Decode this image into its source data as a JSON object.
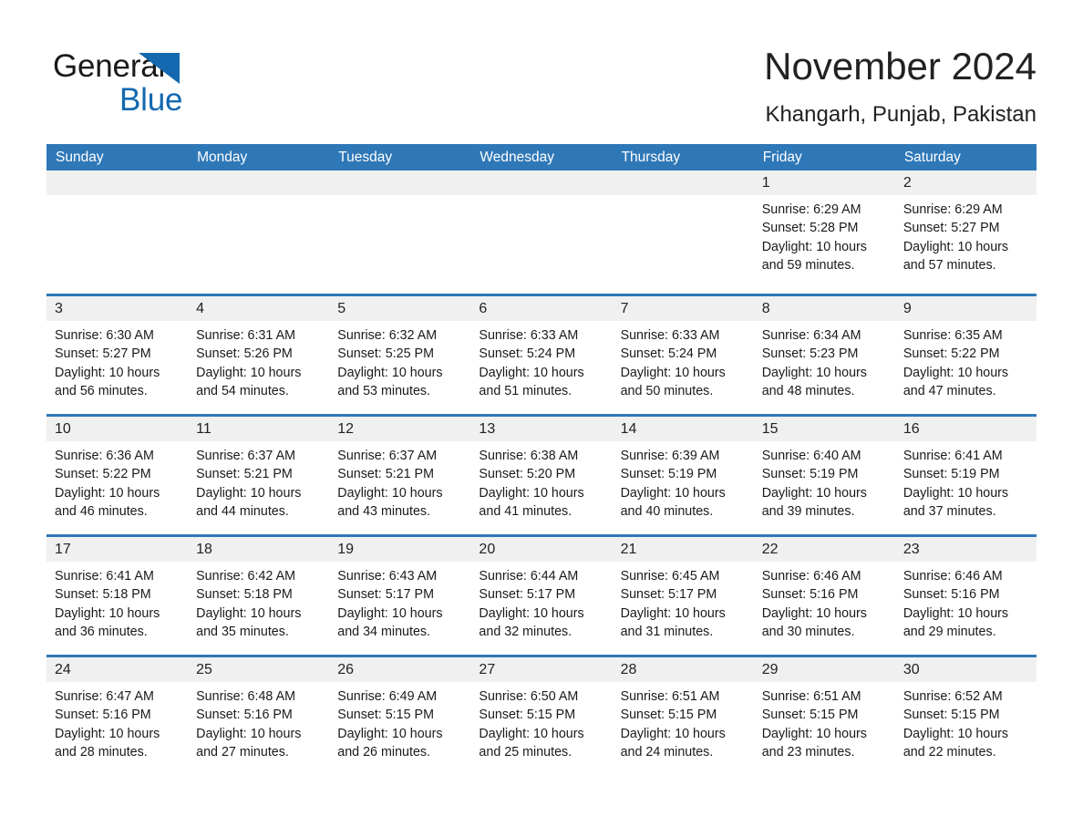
{
  "logo": {
    "word_one": "General",
    "word_two": "Blue",
    "triangle_icon": "triangle-icon",
    "brand_color": "#1368b0"
  },
  "header": {
    "month_title": "November 2024",
    "location": "Khangarh, Punjab, Pakistan"
  },
  "colors": {
    "header_blue": "#2f78b8",
    "day_strip_gray": "#f0f0f0",
    "text": "#1a1a1a"
  },
  "weekdays": [
    "Sunday",
    "Monday",
    "Tuesday",
    "Wednesday",
    "Thursday",
    "Friday",
    "Saturday"
  ],
  "weeks": [
    [
      {
        "day": "",
        "empty": true
      },
      {
        "day": "",
        "empty": true
      },
      {
        "day": "",
        "empty": true
      },
      {
        "day": "",
        "empty": true
      },
      {
        "day": "",
        "empty": true
      },
      {
        "day": "1",
        "sunrise": "Sunrise: 6:29 AM",
        "sunset": "Sunset: 5:28 PM",
        "daylight_1": "Daylight: 10 hours",
        "daylight_2": "and 59 minutes."
      },
      {
        "day": "2",
        "sunrise": "Sunrise: 6:29 AM",
        "sunset": "Sunset: 5:27 PM",
        "daylight_1": "Daylight: 10 hours",
        "daylight_2": "and 57 minutes."
      }
    ],
    [
      {
        "day": "3",
        "sunrise": "Sunrise: 6:30 AM",
        "sunset": "Sunset: 5:27 PM",
        "daylight_1": "Daylight: 10 hours",
        "daylight_2": "and 56 minutes."
      },
      {
        "day": "4",
        "sunrise": "Sunrise: 6:31 AM",
        "sunset": "Sunset: 5:26 PM",
        "daylight_1": "Daylight: 10 hours",
        "daylight_2": "and 54 minutes."
      },
      {
        "day": "5",
        "sunrise": "Sunrise: 6:32 AM",
        "sunset": "Sunset: 5:25 PM",
        "daylight_1": "Daylight: 10 hours",
        "daylight_2": "and 53 minutes."
      },
      {
        "day": "6",
        "sunrise": "Sunrise: 6:33 AM",
        "sunset": "Sunset: 5:24 PM",
        "daylight_1": "Daylight: 10 hours",
        "daylight_2": "and 51 minutes."
      },
      {
        "day": "7",
        "sunrise": "Sunrise: 6:33 AM",
        "sunset": "Sunset: 5:24 PM",
        "daylight_1": "Daylight: 10 hours",
        "daylight_2": "and 50 minutes."
      },
      {
        "day": "8",
        "sunrise": "Sunrise: 6:34 AM",
        "sunset": "Sunset: 5:23 PM",
        "daylight_1": "Daylight: 10 hours",
        "daylight_2": "and 48 minutes."
      },
      {
        "day": "9",
        "sunrise": "Sunrise: 6:35 AM",
        "sunset": "Sunset: 5:22 PM",
        "daylight_1": "Daylight: 10 hours",
        "daylight_2": "and 47 minutes."
      }
    ],
    [
      {
        "day": "10",
        "sunrise": "Sunrise: 6:36 AM",
        "sunset": "Sunset: 5:22 PM",
        "daylight_1": "Daylight: 10 hours",
        "daylight_2": "and 46 minutes."
      },
      {
        "day": "11",
        "sunrise": "Sunrise: 6:37 AM",
        "sunset": "Sunset: 5:21 PM",
        "daylight_1": "Daylight: 10 hours",
        "daylight_2": "and 44 minutes."
      },
      {
        "day": "12",
        "sunrise": "Sunrise: 6:37 AM",
        "sunset": "Sunset: 5:21 PM",
        "daylight_1": "Daylight: 10 hours",
        "daylight_2": "and 43 minutes."
      },
      {
        "day": "13",
        "sunrise": "Sunrise: 6:38 AM",
        "sunset": "Sunset: 5:20 PM",
        "daylight_1": "Daylight: 10 hours",
        "daylight_2": "and 41 minutes."
      },
      {
        "day": "14",
        "sunrise": "Sunrise: 6:39 AM",
        "sunset": "Sunset: 5:19 PM",
        "daylight_1": "Daylight: 10 hours",
        "daylight_2": "and 40 minutes."
      },
      {
        "day": "15",
        "sunrise": "Sunrise: 6:40 AM",
        "sunset": "Sunset: 5:19 PM",
        "daylight_1": "Daylight: 10 hours",
        "daylight_2": "and 39 minutes."
      },
      {
        "day": "16",
        "sunrise": "Sunrise: 6:41 AM",
        "sunset": "Sunset: 5:19 PM",
        "daylight_1": "Daylight: 10 hours",
        "daylight_2": "and 37 minutes."
      }
    ],
    [
      {
        "day": "17",
        "sunrise": "Sunrise: 6:41 AM",
        "sunset": "Sunset: 5:18 PM",
        "daylight_1": "Daylight: 10 hours",
        "daylight_2": "and 36 minutes."
      },
      {
        "day": "18",
        "sunrise": "Sunrise: 6:42 AM",
        "sunset": "Sunset: 5:18 PM",
        "daylight_1": "Daylight: 10 hours",
        "daylight_2": "and 35 minutes."
      },
      {
        "day": "19",
        "sunrise": "Sunrise: 6:43 AM",
        "sunset": "Sunset: 5:17 PM",
        "daylight_1": "Daylight: 10 hours",
        "daylight_2": "and 34 minutes."
      },
      {
        "day": "20",
        "sunrise": "Sunrise: 6:44 AM",
        "sunset": "Sunset: 5:17 PM",
        "daylight_1": "Daylight: 10 hours",
        "daylight_2": "and 32 minutes."
      },
      {
        "day": "21",
        "sunrise": "Sunrise: 6:45 AM",
        "sunset": "Sunset: 5:17 PM",
        "daylight_1": "Daylight: 10 hours",
        "daylight_2": "and 31 minutes."
      },
      {
        "day": "22",
        "sunrise": "Sunrise: 6:46 AM",
        "sunset": "Sunset: 5:16 PM",
        "daylight_1": "Daylight: 10 hours",
        "daylight_2": "and 30 minutes."
      },
      {
        "day": "23",
        "sunrise": "Sunrise: 6:46 AM",
        "sunset": "Sunset: 5:16 PM",
        "daylight_1": "Daylight: 10 hours",
        "daylight_2": "and 29 minutes."
      }
    ],
    [
      {
        "day": "24",
        "sunrise": "Sunrise: 6:47 AM",
        "sunset": "Sunset: 5:16 PM",
        "daylight_1": "Daylight: 10 hours",
        "daylight_2": "and 28 minutes."
      },
      {
        "day": "25",
        "sunrise": "Sunrise: 6:48 AM",
        "sunset": "Sunset: 5:16 PM",
        "daylight_1": "Daylight: 10 hours",
        "daylight_2": "and 27 minutes."
      },
      {
        "day": "26",
        "sunrise": "Sunrise: 6:49 AM",
        "sunset": "Sunset: 5:15 PM",
        "daylight_1": "Daylight: 10 hours",
        "daylight_2": "and 26 minutes."
      },
      {
        "day": "27",
        "sunrise": "Sunrise: 6:50 AM",
        "sunset": "Sunset: 5:15 PM",
        "daylight_1": "Daylight: 10 hours",
        "daylight_2": "and 25 minutes."
      },
      {
        "day": "28",
        "sunrise": "Sunrise: 6:51 AM",
        "sunset": "Sunset: 5:15 PM",
        "daylight_1": "Daylight: 10 hours",
        "daylight_2": "and 24 minutes."
      },
      {
        "day": "29",
        "sunrise": "Sunrise: 6:51 AM",
        "sunset": "Sunset: 5:15 PM",
        "daylight_1": "Daylight: 10 hours",
        "daylight_2": "and 23 minutes."
      },
      {
        "day": "30",
        "sunrise": "Sunrise: 6:52 AM",
        "sunset": "Sunset: 5:15 PM",
        "daylight_1": "Daylight: 10 hours",
        "daylight_2": "and 22 minutes."
      }
    ]
  ]
}
